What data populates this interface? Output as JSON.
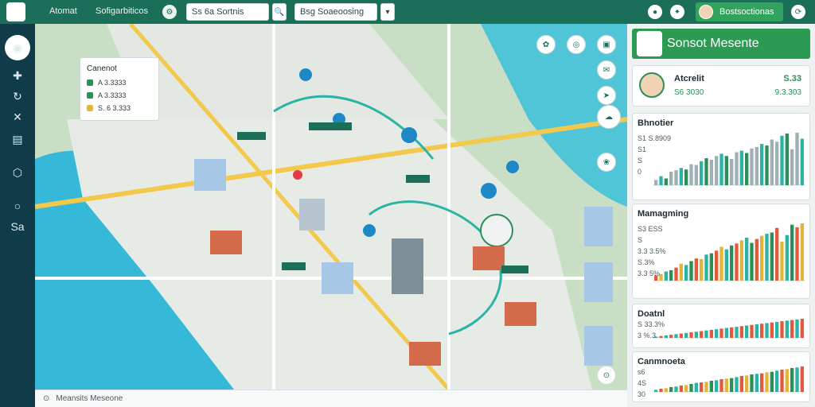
{
  "topbar": {
    "nav_1": "Atomat",
    "nav_2": "Sofigarbiticos",
    "search_value": "Ss 6a Sortnis",
    "filter_value": "Bsg Soaeoosing",
    "user_name": "Bostsoctionas"
  },
  "map": {
    "legend": {
      "title": "Canenot",
      "rows": [
        {
          "label": "A 3.3333",
          "color": "#2b8f57"
        },
        {
          "label": "A 3.3333",
          "color": "#2b8f57"
        },
        {
          "label": "S. 6 3.333",
          "color": "#e2b53a"
        }
      ]
    },
    "bottom_text": "Meansits Meseone"
  },
  "panel": {
    "header_title": "Sonsot Mesente",
    "profile": {
      "name": "Atcrelit",
      "value_1": "S.33",
      "sub_1": "S6 3030",
      "sub_2": "9.3.303"
    },
    "cards": [
      {
        "title": "Bhnotier",
        "labels": [
          "S1 S.8909",
          "S1",
          "S",
          "0"
        ],
        "values": [
          7,
          12,
          9,
          18,
          20,
          23,
          21,
          28,
          27,
          32,
          36,
          34,
          39,
          42,
          39,
          35,
          44,
          46,
          43,
          49,
          51,
          55,
          53,
          61,
          58,
          66,
          69,
          48,
          70,
          62
        ],
        "colors": [
          "#9fb0b6",
          "#2bb3a5",
          "#2b8f57",
          "#9fb0b6"
        ]
      },
      {
        "title": "Mamagming",
        "labels": [
          "S3 ESS",
          "S",
          "3.3 3.5%",
          "S.3%",
          "3.3 5%"
        ],
        "values": [
          8,
          10,
          14,
          16,
          20,
          26,
          24,
          30,
          34,
          33,
          40,
          42,
          46,
          52,
          48,
          54,
          57,
          62,
          66,
          58,
          64,
          69,
          72,
          74,
          81,
          60,
          70,
          86,
          82,
          88
        ],
        "colors": [
          "#e25a3a",
          "#e2b53a",
          "#2bb3a5",
          "#2b8f57"
        ]
      },
      {
        "title": "Doatnl",
        "labels": [
          "S 33.3%",
          "3 %.3"
        ],
        "values": [
          4,
          6,
          8,
          10,
          12,
          14,
          16,
          18,
          20,
          22,
          24,
          26,
          28,
          30,
          32,
          34,
          36,
          38,
          40,
          42,
          44,
          46,
          48,
          50,
          52,
          54,
          56,
          58,
          60,
          62
        ],
        "colors": [
          "#2bb3a5",
          "#e25a3a"
        ]
      },
      {
        "title": "Canmnoeta",
        "labels": [
          "s6",
          "4S",
          "30"
        ],
        "values": [
          4,
          6,
          7,
          9,
          10,
          12,
          13,
          15,
          17,
          18,
          19,
          21,
          22,
          24,
          25,
          26,
          28,
          30,
          31,
          33,
          34,
          35,
          37,
          38,
          40,
          42,
          43,
          45,
          46,
          48
        ],
        "colors": [
          "#2bb3a5",
          "#e25a3a",
          "#e2b53a",
          "#2b8f57"
        ]
      }
    ]
  }
}
